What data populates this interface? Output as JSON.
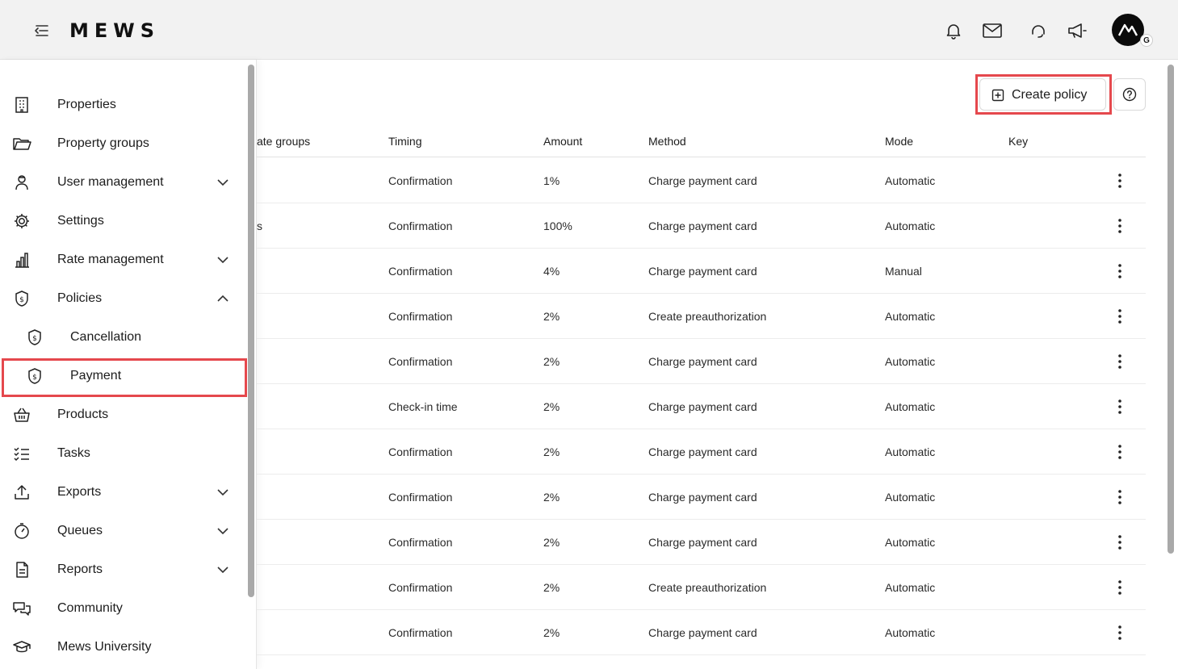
{
  "header": {
    "logo": "MEWS",
    "avatar_badge": "G",
    "icons": [
      "menu-collapse-icon",
      "bell-icon",
      "mail-icon",
      "headset-icon",
      "megaphone-icon"
    ]
  },
  "sidebar": {
    "items": [
      {
        "label": "Properties",
        "icon": "building-icon"
      },
      {
        "label": "Property groups",
        "icon": "folder-icon"
      },
      {
        "label": "User management",
        "icon": "user-icon",
        "chevron": "down"
      },
      {
        "label": "Settings",
        "icon": "gear-icon"
      },
      {
        "label": "Rate management",
        "icon": "bar-chart-icon",
        "chevron": "down"
      },
      {
        "label": "Policies",
        "icon": "shield-dollar-icon",
        "chevron": "up"
      },
      {
        "label": "Cancellation",
        "icon": "shield-dollar-icon",
        "sub": true
      },
      {
        "label": "Payment",
        "icon": "shield-dollar-icon",
        "sub": true,
        "selected": true
      },
      {
        "label": "Products",
        "icon": "basket-icon"
      },
      {
        "label": "Tasks",
        "icon": "checklist-icon"
      },
      {
        "label": "Exports",
        "icon": "upload-icon",
        "chevron": "down"
      },
      {
        "label": "Queues",
        "icon": "stopwatch-icon",
        "chevron": "down"
      },
      {
        "label": "Reports",
        "icon": "document-icon",
        "chevron": "down"
      },
      {
        "label": "Community",
        "icon": "chat-bubbles-icon"
      },
      {
        "label": "Mews University",
        "icon": "graduation-cap-icon"
      }
    ]
  },
  "toolbar": {
    "create_label": "Create policy"
  },
  "table": {
    "columns": [
      "ate groups",
      "Timing",
      "Amount",
      "Method",
      "Mode",
      "Key"
    ],
    "rows": [
      {
        "rate": "",
        "timing": "Confirmation",
        "amount": "1%",
        "method": "Charge payment card",
        "mode": "Automatic",
        "key": ""
      },
      {
        "rate": "s",
        "timing": "Confirmation",
        "amount": "100%",
        "method": "Charge payment card",
        "mode": "Automatic",
        "key": ""
      },
      {
        "rate": "",
        "timing": "Confirmation",
        "amount": "4%",
        "method": "Charge payment card",
        "mode": "Manual",
        "key": ""
      },
      {
        "rate": "",
        "timing": "Confirmation",
        "amount": "2%",
        "method": "Create preauthorization",
        "mode": "Automatic",
        "key": ""
      },
      {
        "rate": "",
        "timing": "Confirmation",
        "amount": "2%",
        "method": "Charge payment card",
        "mode": "Automatic",
        "key": ""
      },
      {
        "rate": "",
        "timing": "Check-in time",
        "amount": "2%",
        "method": "Charge payment card",
        "mode": "Automatic",
        "key": ""
      },
      {
        "rate": "",
        "timing": "Confirmation",
        "amount": "2%",
        "method": "Charge payment card",
        "mode": "Automatic",
        "key": ""
      },
      {
        "rate": "",
        "timing": "Confirmation",
        "amount": "2%",
        "method": "Charge payment card",
        "mode": "Automatic",
        "key": ""
      },
      {
        "rate": "",
        "timing": "Confirmation",
        "amount": "2%",
        "method": "Charge payment card",
        "mode": "Automatic",
        "key": ""
      },
      {
        "rate": "",
        "timing": "Confirmation",
        "amount": "2%",
        "method": "Create preauthorization",
        "mode": "Automatic",
        "key": ""
      },
      {
        "rate": "",
        "timing": "Confirmation",
        "amount": "2%",
        "method": "Charge payment card",
        "mode": "Automatic",
        "key": ""
      }
    ]
  },
  "colors": {
    "highlight": "#e5484d",
    "header_bg": "#f2f2f2",
    "text": "#1c1c1c"
  }
}
